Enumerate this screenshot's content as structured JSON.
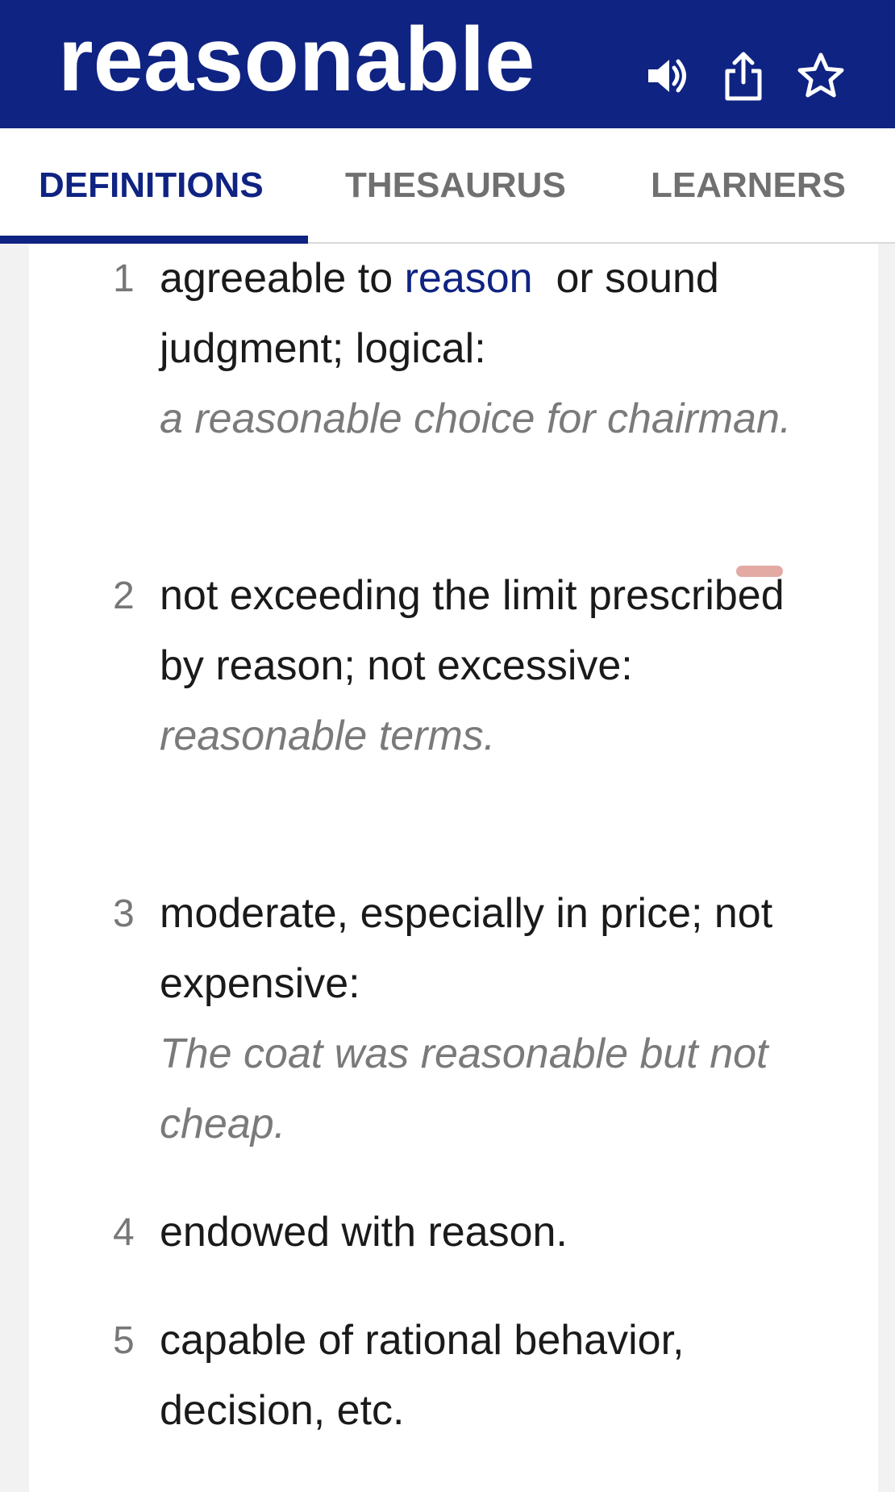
{
  "header": {
    "word": "reasonable",
    "icons": [
      "speaker-icon",
      "share-icon",
      "star-icon"
    ],
    "background": "#0f2382"
  },
  "tabs": [
    {
      "label": "DEFINITIONS",
      "active": true
    },
    {
      "label": "THESAURUS",
      "active": false
    },
    {
      "label": "LEARNERS",
      "active": false
    }
  ],
  "definitions": [
    {
      "number": "1",
      "text_before": "agreeable to ",
      "link": "reason",
      "text_after": "  or sound judgment; logical:",
      "example": "a reasonable choice for chairman."
    },
    {
      "number": "2",
      "text": "not exceeding the limit prescribed by reason; not excessive:",
      "example": "reasonable terms."
    },
    {
      "number": "3",
      "text": "moderate, especially in price; not expensive:",
      "example": "The coat was reasonable but not cheap."
    },
    {
      "number": "4",
      "text": "endowed with reason."
    },
    {
      "number": "5",
      "text": "capable of rational behavior, decision, etc."
    }
  ],
  "colors": {
    "accent": "#0f2382",
    "example_text": "#7a7a7a",
    "inactive_tab": "#707070"
  }
}
